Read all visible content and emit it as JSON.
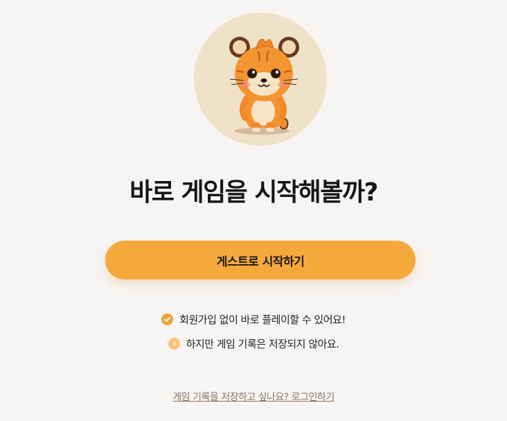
{
  "headline": "바로 게임을 시작해볼까?",
  "guest_button": {
    "label": "게스트로 시작하기"
  },
  "notes": [
    {
      "icon": "check-circle-icon",
      "text": "회원가입 없이 바로 플레이할 수 있어요!"
    },
    {
      "icon": "info-icon",
      "text": "하지만 게임 기록은 저장되지 않아요."
    }
  ],
  "login_link": {
    "text": "게임 기록을 저장하고 싶나요? 로그인하기"
  },
  "colors": {
    "background": "#f7f5f4",
    "accent": "#f5a93d",
    "mascot_circle": "#efe2c8",
    "link": "#8c7360"
  }
}
